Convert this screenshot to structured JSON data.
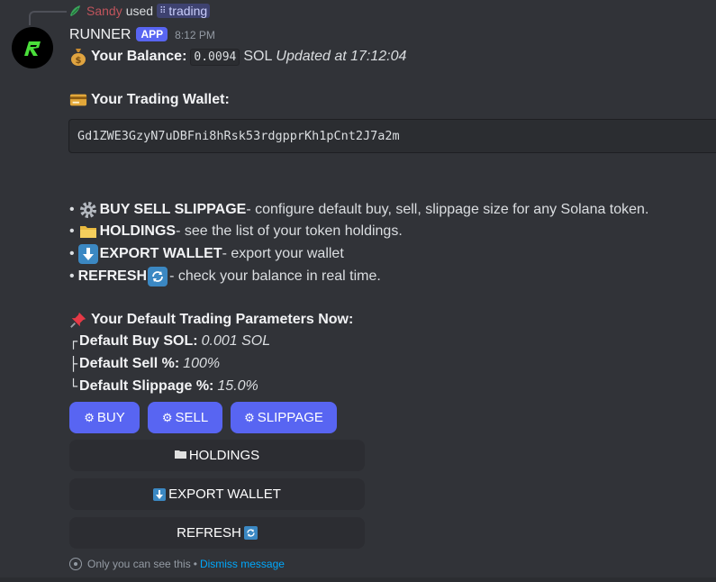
{
  "reply": {
    "user": "Sandy",
    "used_text": "used",
    "command": "trading"
  },
  "message": {
    "bot_name": "RUNNER",
    "app_badge": "APP",
    "timestamp": "8:12 PM",
    "balance_label": "Your Balance:",
    "balance_value": "0.0094",
    "balance_unit": "SOL",
    "updated_text": "Updated at 17:12:04",
    "wallet_label": "Your Trading Wallet:",
    "wallet_address": "Gd1ZWE3GzyN7uDBFni8hRsk53rdgpprKh1pCnt2J7a2m",
    "features": [
      {
        "title": "BUY SELL SLIPPAGE",
        "desc": " - configure default buy, sell, slippage size for any Solana token."
      },
      {
        "title": "HOLDINGS",
        "desc": " - see the list of your token holdings."
      },
      {
        "title": "EXPORT WALLET",
        "desc": " - export your wallet"
      },
      {
        "title": "REFRESH",
        "desc": " -  check your balance in real time."
      }
    ],
    "params_title": "Your Default Trading Parameters Now:",
    "params": [
      {
        "label": "Default Buy SOL:",
        "value": "0.001 SOL"
      },
      {
        "label": "Default Sell %:",
        "value": "100%"
      },
      {
        "label": "Default Slippage %:",
        "value": "15.0%"
      }
    ]
  },
  "buttons": {
    "buy": "BUY",
    "sell": "SELL",
    "slippage": "SLIPPAGE",
    "holdings": "HOLDINGS",
    "export_wallet": "EXPORT WALLET",
    "refresh": "REFRESH"
  },
  "footer": {
    "only_you": "Only you can see this",
    "separator": "•",
    "dismiss": "Dismiss message"
  },
  "icons": {
    "gear": "gear-icon",
    "money_bag": "money-bag-icon",
    "card": "credit-card-icon",
    "folder": "folder-icon",
    "down_arrow": "down-arrow-icon",
    "refresh": "refresh-icon",
    "pin": "pushpin-icon"
  },
  "colors": {
    "background": "#313338",
    "primary_button": "#5865f2",
    "secondary_button": "#2c2d32",
    "link": "#00a8fc",
    "reply_user": "#c0545c"
  }
}
